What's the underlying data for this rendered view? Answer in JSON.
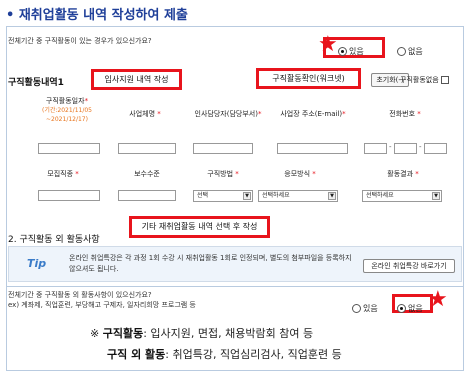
{
  "heading": "• 재취업활동 내역 작성하여 제출",
  "question1": "전체기간 중 구직활동이 있는 경우가 있으신가요?",
  "radio_yes": "있음",
  "radio_no": "없음",
  "q1_selected": "yes",
  "section1_title": "구직활동내역1",
  "tag_support": "입사지원 내역 작성",
  "btn_confirm": "구직활동확인(워크넷)",
  "btn_reset": "초기화(-)",
  "no_activity_label": "구직활동없음",
  "headers_row1": {
    "date": "구직활동일자",
    "date_range": "(기간:2021/11/05 ~2021/12/17)",
    "company": "사업체명",
    "contact": "인사담당자(담당부서)",
    "address": "사업장 주소(E-mail)",
    "phone": "전화번호"
  },
  "headers_row2": {
    "job": "모집직종",
    "pay": "보수수준",
    "method": "구직방법",
    "apply": "응모방식",
    "result": "활동결과"
  },
  "select_values": {
    "method": "선택",
    "apply": "선택하세요",
    "result": "선택하세요"
  },
  "phone_sep": "-",
  "section2_title": "2. 구직활동 외 활동사항",
  "tag_other": "기타 재취업활동 내역 선택 후 작성",
  "notice_icon": "Tip",
  "notice_text": "온라인 취업특강은 각 과정 1회 수강 시 재취업활동 1회로 인정되며, 별도의 첨부파일을 등록하지 않으셔도 됩니다.",
  "btn_online": "온라인 취업특강 바로가기",
  "question2_line1": "전체기간 중 구직활동 외 활동사항이 있으신가요?",
  "question2_line2": "ex) 계좌제, 직업훈련, 부당해고 구제자, 일자리희망 프로그램 등",
  "q2_selected": "no",
  "summary_mark": "※",
  "summary_label1": "구직활동",
  "summary_text1": ": 입사지원, 면접, 채용박람회 참여 등",
  "summary_label2": "구직 외 활동",
  "summary_text2": ": 취업특강, 직업심리검사, 직업훈련 등",
  "star_icon": "star-icon",
  "required_mark": "*",
  "colors": {
    "accent": "#e8141c",
    "heading": "#1f3f99",
    "panel_border": "#b9cbe0"
  }
}
